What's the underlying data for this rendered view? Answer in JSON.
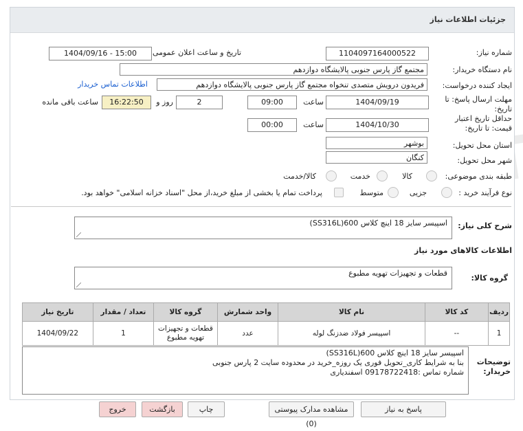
{
  "header": {
    "title": "جزئیات اطلاعات نیاز"
  },
  "form": {
    "need_number_label": "شماره نیاز:",
    "need_number": "1104097164000522",
    "announce_label": "تاریخ و ساعت اعلان عمومی:",
    "announce_value": "1404/09/16 - 15:00",
    "buyer_org_label": "نام دستگاه خریدار:",
    "buyer_org": "مجتمع گاز پارس جنوبی  پالایشگاه دوازدهم",
    "requester_label": "ایجاد کننده درخواست:",
    "requester": "فریدون درویش متصدی تنخواه مجتمع گاز پارس جنوبی  پالایشگاه دوازدهم",
    "contact_link": "اطلاعات تماس خریدار",
    "reply_deadline_label": "مهلت ارسال پاسخ: تا تاریخ:",
    "reply_date": "1404/09/19",
    "time_label": "ساعت",
    "reply_time": "09:00",
    "days_label": "روز و",
    "days_value": "2",
    "remaining_time": "16:22:50",
    "remaining_label": "ساعت باقی مانده",
    "validity_label": "حداقل تاریخ اعتبار قیمت: تا تاریخ:",
    "validity_date": "1404/10/30",
    "validity_time": "00:00",
    "province_label": "استان محل تحویل:",
    "province": "بوشهر",
    "city_label": "شهر محل تحویل:",
    "city": "کنگان",
    "category_label": "طبقه بندی موضوعی:",
    "category_options": [
      "کالا",
      "خدمت",
      "کالا/خدمت"
    ],
    "process_label": "نوع فرآیند خرید :",
    "process_options": [
      "جزیی",
      "متوسط"
    ],
    "payment_note": "پرداخت تمام یا بخشی از مبلغ خرید،از محل \"اسناد خزانه اسلامی\" خواهد بود."
  },
  "summary": {
    "label": "شرح کلی نیاز:",
    "text": "اسپیسر سایز 18 اینچ کلاس 600(SS316L)"
  },
  "goods_info": {
    "title": "اطلاعات کالاهای مورد نیاز",
    "group_label": "گروه کالا:",
    "group_value": "قطعات و تجهیزات تهویه مطبوع"
  },
  "table": {
    "headers": [
      "ردیف",
      "کد کالا",
      "نام کالا",
      "واحد شمارش",
      "گروه کالا",
      "تعداد / مقدار",
      "تاریخ نیاز"
    ],
    "rows": [
      [
        "1",
        "--",
        "اسپیسر فولاد ضدزنگ لوله",
        "عدد",
        "قطعات و تجهیزات تهویه مطبوع",
        "1",
        "1404/09/22"
      ]
    ]
  },
  "buyer_notes": {
    "label": "توضیحات خریدار:",
    "lines": [
      "اسپیسر سایز 18 اینچ کلاس 600(SS316L)",
      "بنا به شرایط کاری_تحویل فوری یک روزه_خرید در محدوده سایت 2 پارس جنوبی",
      "شماره تماس :09178722418 اسفندیاری"
    ]
  },
  "buttons": {
    "reply": "پاسخ به نیاز",
    "attachments": "مشاهده مدارک پیوستی (0)",
    "print": "چاپ",
    "back": "بازگشت",
    "exit": "خروج"
  }
}
